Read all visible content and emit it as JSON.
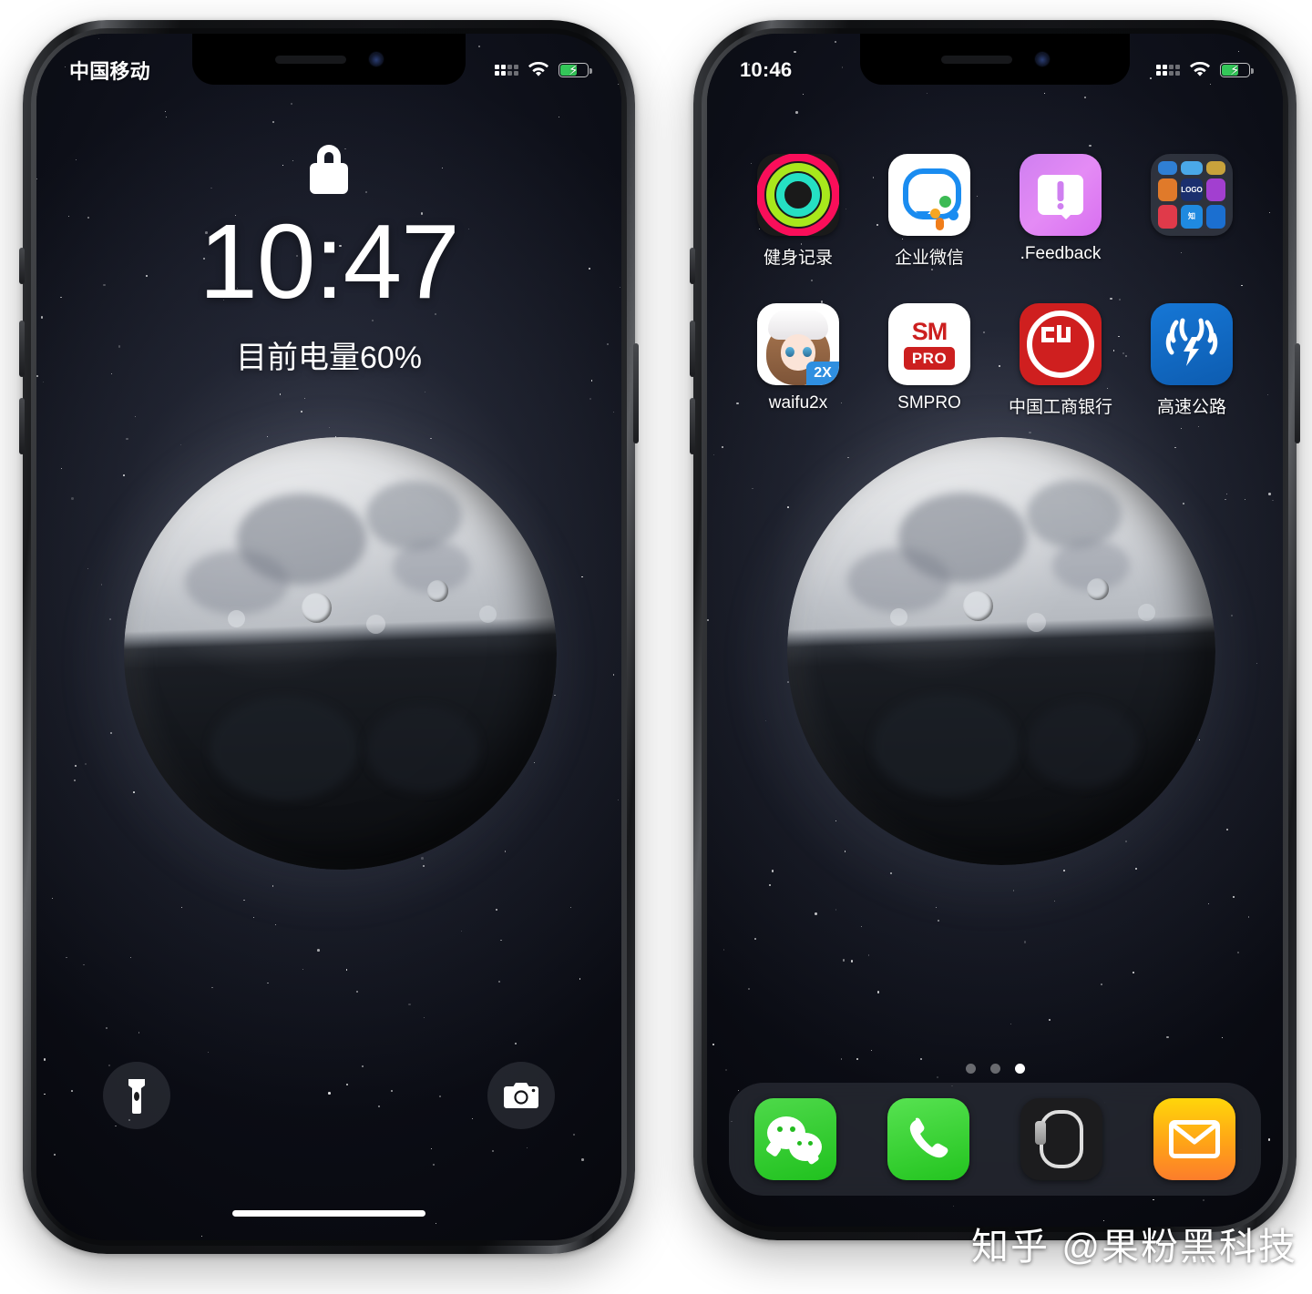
{
  "watermark": "知乎 @果粉黑科技",
  "left_phone": {
    "name": "lock-screen-phone",
    "status_bar": {
      "carrier": "中国移动",
      "signal_icon": "signal-dots-icon",
      "wifi_icon": "wifi-icon",
      "battery_icon": "battery-charging-icon",
      "battery_color": "#34c759",
      "battery_level_pct": 60,
      "charging": true
    },
    "lock_icon": "lock-icon",
    "clock": "10:47",
    "battery_text": "目前电量60%",
    "flashlight_icon": "flashlight-icon",
    "camera_icon": "camera-icon",
    "home_indicator": "home-indicator"
  },
  "right_phone": {
    "name": "home-screen-phone",
    "status_bar": {
      "time": "10:46",
      "signal_icon": "signal-dots-icon",
      "wifi_icon": "wifi-icon",
      "battery_icon": "battery-charging-icon",
      "battery_color": "#34c759",
      "battery_level_pct": 60,
      "charging": true
    },
    "apps": [
      {
        "label": "健身记录",
        "icon": "fitness-rings-icon"
      },
      {
        "label": "企业微信",
        "icon": "wecom-icon"
      },
      {
        "label": ".Feedback",
        "icon": "feedback-icon"
      },
      {
        "label": "",
        "icon": "app-folder-icon"
      },
      {
        "label": "waifu2x",
        "icon": "waifu2x-icon",
        "badge": "2X"
      },
      {
        "label": "SMPRO",
        "icon": "smpro-icon",
        "top_text": "SM",
        "bottom_text": "PRO"
      },
      {
        "label": "中国工商银行",
        "icon": "icbc-icon"
      },
      {
        "label": "高速公路",
        "icon": "highway-icon"
      }
    ],
    "folder_mini_icons": [
      {
        "name": "mini-icon-1",
        "color": "#2f7fd4"
      },
      {
        "name": "mini-icon-2",
        "color": "#4aa8e8"
      },
      {
        "name": "mini-icon-3",
        "color": "#c8a23c"
      },
      {
        "name": "mini-icon-4",
        "color": "#e07a2a"
      },
      {
        "name": "mini-icon-5",
        "color": "#1b2f6e",
        "text": "LOGO"
      },
      {
        "name": "mini-icon-6",
        "color": "#a23fd0"
      },
      {
        "name": "mini-icon-7",
        "color": "#e03a4a"
      },
      {
        "name": "mini-icon-8",
        "color": "#1f8ae0",
        "text": "知"
      },
      {
        "name": "mini-icon-9",
        "color": "#1b6fd0"
      }
    ],
    "page_dots": {
      "count": 3,
      "active_index": 2
    },
    "dock": [
      {
        "label": "WeChat",
        "icon": "wechat-icon"
      },
      {
        "label": "Phone",
        "icon": "phone-icon"
      },
      {
        "label": "Watch",
        "icon": "watch-icon"
      },
      {
        "label": "Mail",
        "icon": "mail-icon"
      }
    ],
    "home_indicator": "home-indicator"
  },
  "wallpaper": {
    "name": "moon-wallpaper",
    "subject": "moon"
  }
}
